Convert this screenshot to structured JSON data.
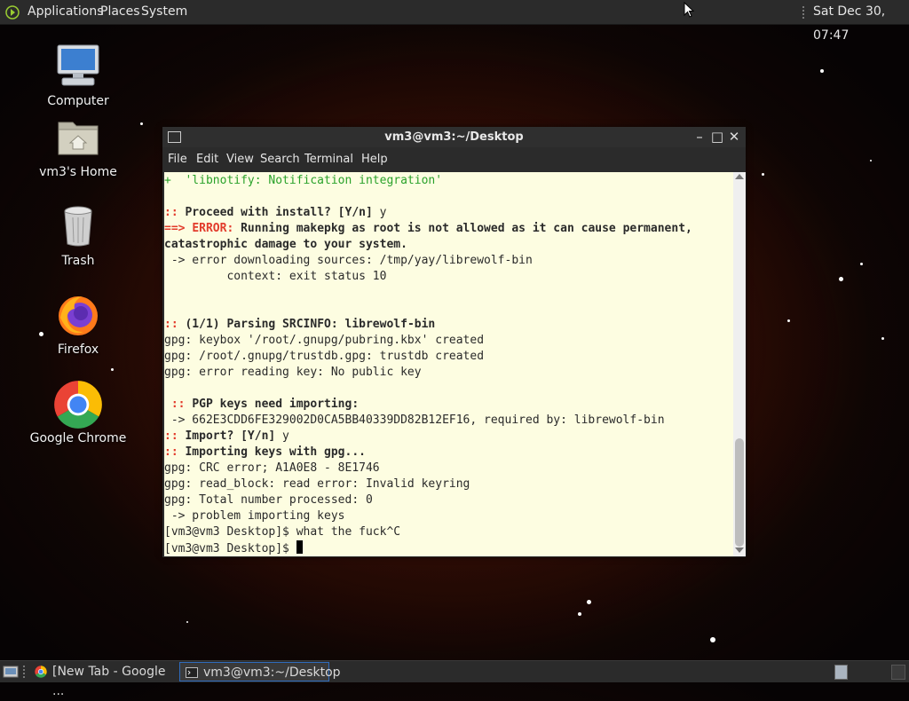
{
  "top_panel": {
    "menus": [
      "Applications",
      "Places",
      "System"
    ],
    "clock": "Sat Dec 30, 07:47"
  },
  "desktop_icons": [
    {
      "label": "Computer",
      "icon": "computer-icon"
    },
    {
      "label": "vm3's Home",
      "icon": "home-folder-icon"
    },
    {
      "label": "Trash",
      "icon": "trash-icon"
    },
    {
      "label": "Firefox",
      "icon": "firefox-icon"
    },
    {
      "label": "Google Chrome",
      "icon": "chrome-icon"
    }
  ],
  "terminal": {
    "title": "vm3@vm3:~/Desktop",
    "menu": [
      "File",
      "Edit",
      "View",
      "Search",
      "Terminal",
      "Help"
    ],
    "lines": {
      "l1": "+  'libnotify: Notification integration'",
      "l3_a": ":: ",
      "l3_b": "Proceed with install? [Y/n]",
      "l3_c": " y",
      "l4_a": "==> ",
      "l4_b": "ERROR:",
      "l4_c": " Running makepkg as root is not allowed as it can cause permanent,",
      "l5": "catastrophic damage to your system.",
      "l6": " -> error downloading sources: /tmp/yay/librewolf-bin",
      "l7": "         context: exit status 10",
      "l10_a": ":: ",
      "l10_b": "(1/1) Parsing SRCINFO: librewolf-bin",
      "l11": "gpg: keybox '/root/.gnupg/pubring.kbx' created",
      "l12": "gpg: /root/.gnupg/trustdb.gpg: trustdb created",
      "l13": "gpg: error reading key: No public key",
      "l15_a": " :: ",
      "l15_b": "PGP keys need importing:",
      "l16": " -> 662E3CDD6FE329002D0CA5BB40339DD82B12EF16, required by: librewolf-bin",
      "l17_a": ":: ",
      "l17_b": "Import? [Y/n]",
      "l17_c": " y",
      "l18_a": ":: ",
      "l18_b": "Importing keys with gpg...",
      "l19": "gpg: CRC error; A1A0E8 - 8E1746",
      "l20": "gpg: read_block: read error: Invalid keyring",
      "l21": "gpg: Total number processed: 0",
      "l22": " -> problem importing keys",
      "l23": "[vm3@vm3 Desktop]$ what the fuck^C",
      "l24": "[vm3@vm3 Desktop]$ "
    }
  },
  "taskbar": {
    "items": [
      {
        "label": "[New Tab - Google ...",
        "icon": "chrome-icon"
      },
      {
        "label": "vm3@vm3:~/Desktop",
        "icon": "terminal-icon"
      }
    ]
  }
}
